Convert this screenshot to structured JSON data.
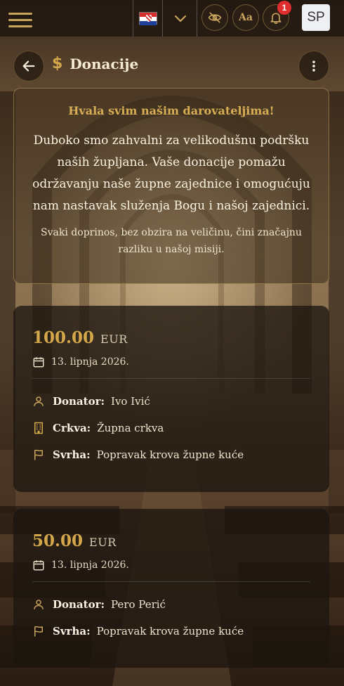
{
  "colors": {
    "accent": "#d4a84a",
    "badge": "#e02d2d"
  },
  "topbar": {
    "language_flag": "croatia-flag",
    "notification_count": "1",
    "font_toggle_label": "Aa",
    "avatar_initials": "SP"
  },
  "header": {
    "title": "Donacije",
    "icon": "dollar-icon",
    "dollar_symbol": "$"
  },
  "thanks": {
    "title": "Hvala svim našim darovateljima!",
    "body": "Duboko smo zahvalni za velikodušnu podršku naših župljana. Vaše donacije pomažu održavanju naše župne zajednice i omogućuju nam nastavak služenja Bogu i našoj zajednici.",
    "sub": "Svaki doprinos, bez obzira na veličinu, čini značajnu razliku u našoj misiji."
  },
  "donations": [
    {
      "amount": "100.00",
      "currency": "EUR",
      "date": "13. lipnja 2026.",
      "donor_label": "Donator:",
      "donor": "Ivo Ivić",
      "church_label": "Crkva:",
      "church": "Župna crkva",
      "purpose_label": "Svrha:",
      "purpose": "Popravak krova župne kuće"
    },
    {
      "amount": "50.00",
      "currency": "EUR",
      "date": "13. lipnja 2026.",
      "donor_label": "Donator:",
      "donor": "Pero Perić",
      "purpose_label": "Svrha:",
      "purpose": "Popravak krova župne kuće"
    }
  ]
}
